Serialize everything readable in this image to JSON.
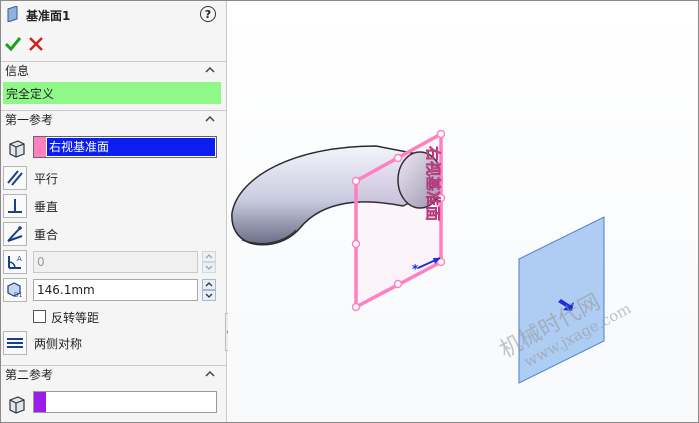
{
  "panel": {
    "title": "基准面1",
    "help_symbol": "?",
    "sections": {
      "info": {
        "title": "信息",
        "status": "完全定义"
      },
      "first_ref": {
        "title": "第一参考",
        "selection": "右视基准面",
        "options": [
          "平行",
          "垂直",
          "重合"
        ],
        "angle_value": "0",
        "distance_value": "146.1mm",
        "flip_label": "反转等距",
        "symmetric_label": "两侧对称"
      },
      "second_ref": {
        "title": "第二参考",
        "selection": ""
      }
    }
  },
  "viewport": {
    "plane_label": "右视基准面",
    "watermark_cn": "机械时代网",
    "watermark_url": "www.jxage.com"
  },
  "colors": {
    "status_green": "#90f889",
    "selection_pink": "#ff7fbf",
    "second_selection_purple": "#9b1de8",
    "plane_preview": "#ff7fbf",
    "plane_reference": "#a8c8f4"
  }
}
